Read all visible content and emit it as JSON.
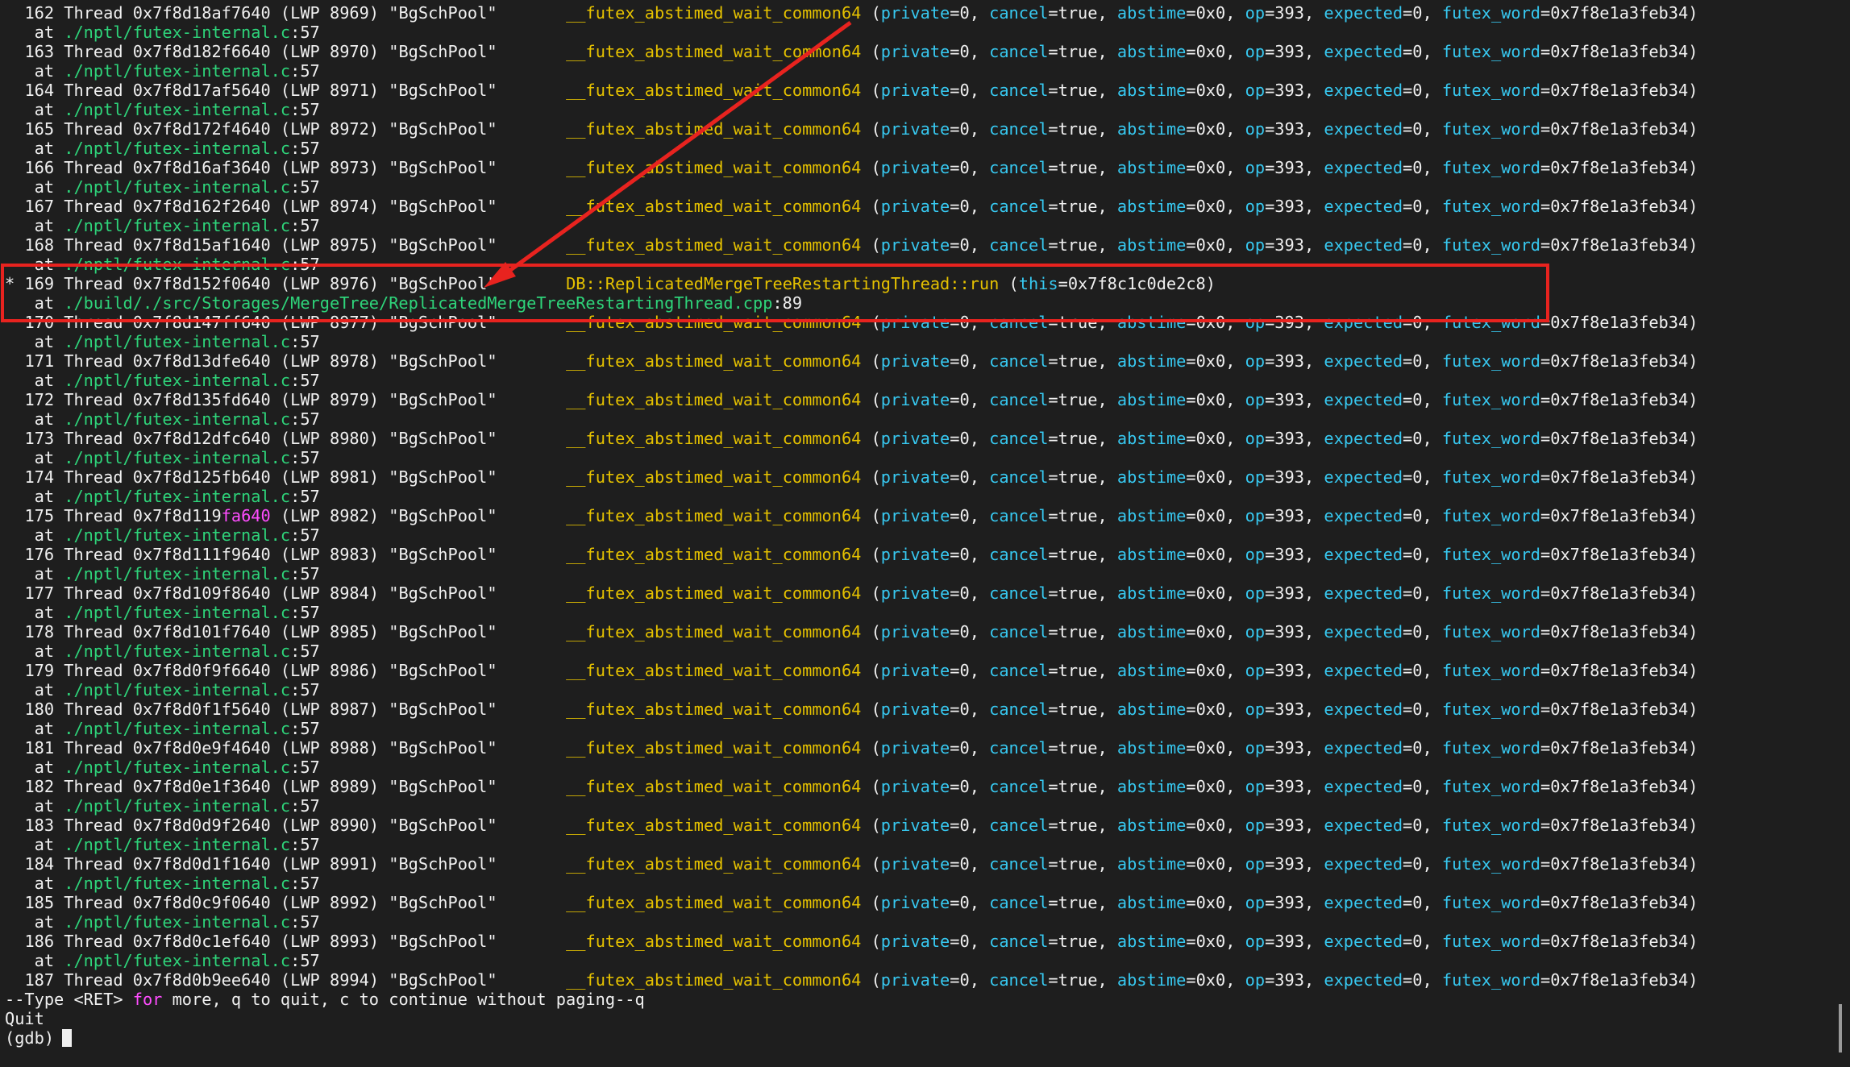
{
  "thread_rows": [
    {
      "marker": " ",
      "id": "162",
      "addr_main": "0x7f8d18af7640",
      "addr_hl": "",
      "lwp": "8969"
    },
    {
      "marker": " ",
      "id": "163",
      "addr_main": "0x7f8d182f6640",
      "addr_hl": "",
      "lwp": "8970"
    },
    {
      "marker": " ",
      "id": "164",
      "addr_main": "0x7f8d17af5640",
      "addr_hl": "",
      "lwp": "8971"
    },
    {
      "marker": " ",
      "id": "165",
      "addr_main": "0x7f8d172f4640",
      "addr_hl": "",
      "lwp": "8972"
    },
    {
      "marker": " ",
      "id": "166",
      "addr_main": "0x7f8d16af3640",
      "addr_hl": "",
      "lwp": "8973"
    },
    {
      "marker": " ",
      "id": "167",
      "addr_main": "0x7f8d162f2640",
      "addr_hl": "",
      "lwp": "8974"
    },
    {
      "marker": " ",
      "id": "168",
      "addr_main": "0x7f8d15af1640",
      "addr_hl": "",
      "lwp": "8975"
    },
    {
      "marker": "*",
      "id": "169",
      "addr_main": "0x7f8d152f0640",
      "addr_hl": "",
      "lwp": "8976"
    },
    {
      "marker": " ",
      "id": "170",
      "addr_main": "0x7f8d147ff640",
      "addr_hl": "",
      "lwp": "8977"
    },
    {
      "marker": " ",
      "id": "171",
      "addr_main": "0x7f8d13dfe640",
      "addr_hl": "",
      "lwp": "8978"
    },
    {
      "marker": " ",
      "id": "172",
      "addr_main": "0x7f8d135fd640",
      "addr_hl": "",
      "lwp": "8979"
    },
    {
      "marker": " ",
      "id": "173",
      "addr_main": "0x7f8d12dfc640",
      "addr_hl": "",
      "lwp": "8980"
    },
    {
      "marker": " ",
      "id": "174",
      "addr_main": "0x7f8d125fb640",
      "addr_hl": "",
      "lwp": "8981"
    },
    {
      "marker": " ",
      "id": "175",
      "addr_main": "0x7f8d119",
      "addr_hl": "fa640",
      "lwp": "8982"
    },
    {
      "marker": " ",
      "id": "176",
      "addr_main": "0x7f8d111f9640",
      "addr_hl": "",
      "lwp": "8983"
    },
    {
      "marker": " ",
      "id": "177",
      "addr_main": "0x7f8d109f8640",
      "addr_hl": "",
      "lwp": "8984"
    },
    {
      "marker": " ",
      "id": "178",
      "addr_main": "0x7f8d101f7640",
      "addr_hl": "",
      "lwp": "8985"
    },
    {
      "marker": " ",
      "id": "179",
      "addr_main": "0x7f8d0f9f6640",
      "addr_hl": "",
      "lwp": "8986"
    },
    {
      "marker": " ",
      "id": "180",
      "addr_main": "0x7f8d0f1f5640",
      "addr_hl": "",
      "lwp": "8987"
    },
    {
      "marker": " ",
      "id": "181",
      "addr_main": "0x7f8d0e9f4640",
      "addr_hl": "",
      "lwp": "8988"
    },
    {
      "marker": " ",
      "id": "182",
      "addr_main": "0x7f8d0e1f3640",
      "addr_hl": "",
      "lwp": "8989"
    },
    {
      "marker": " ",
      "id": "183",
      "addr_main": "0x7f8d0d9f2640",
      "addr_hl": "",
      "lwp": "8990"
    },
    {
      "marker": " ",
      "id": "184",
      "addr_main": "0x7f8d0d1f1640",
      "addr_hl": "",
      "lwp": "8991"
    },
    {
      "marker": " ",
      "id": "185",
      "addr_main": "0x7f8d0c9f0640",
      "addr_hl": "",
      "lwp": "8992"
    },
    {
      "marker": " ",
      "id": "186",
      "addr_main": "0x7f8d0c1ef640",
      "addr_hl": "",
      "lwp": "8993"
    },
    {
      "marker": " ",
      "id": "187",
      "addr_main": "0x7f8d0b9ee640",
      "addr_hl": "",
      "lwp": "8994"
    }
  ],
  "thread_name": "\"BgSchPool\"",
  "futex_call": {
    "function": "__futex_abstimed_wait_common64",
    "args": [
      {
        "key": "private",
        "value": "0"
      },
      {
        "key": "cancel",
        "value": "true"
      },
      {
        "key": "abstime",
        "value": "0x0"
      },
      {
        "key": "op",
        "value": "393"
      },
      {
        "key": "expected",
        "value": "0"
      },
      {
        "key": "futex_word",
        "value": "0x7f8e1a3feb34"
      }
    ],
    "file": "./nptl/futex-internal.c",
    "line": "57"
  },
  "current_frame": {
    "function": "DB::ReplicatedMergeTreeRestartingThread::run",
    "arg_key": "this",
    "arg_value": "0x7f8c1c0de2c8",
    "file": "./build/./src/Storages/MergeTree/ReplicatedMergeTreeRestartingThread.cpp",
    "line": "89"
  },
  "pager_prompt": {
    "prefix": "--Type <RET> ",
    "keyword": "for",
    "suffix": " more, q to quit, c to continue without paging--q"
  },
  "quit_text": "Quit",
  "gdb_prompt": "(gdb) ",
  "annotation_color": "#e8231f",
  "colors": {
    "background": "#1e1e1e",
    "function": "#e5c100",
    "argument": "#37c8f0",
    "keyword": "#ff4dff",
    "path": "#2ed47a"
  }
}
